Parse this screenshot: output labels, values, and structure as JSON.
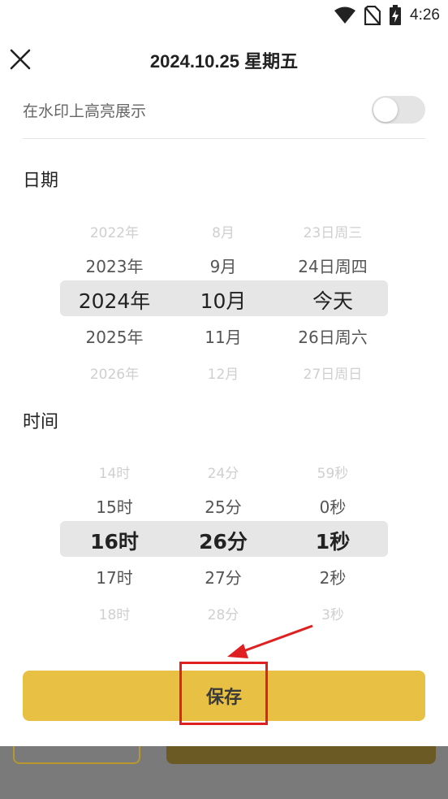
{
  "status_bar": {
    "time": "4:26",
    "icons": [
      "wifi-icon",
      "no-sim-icon",
      "battery-charging-icon"
    ]
  },
  "header": {
    "title": "2024.10.25 星期五",
    "close_icon": "close-icon"
  },
  "watermark_setting": {
    "label": "在水印上高亮展示",
    "enabled": false
  },
  "date_section": {
    "title": "日期",
    "columns": [
      {
        "name": "year",
        "items": [
          "2022年",
          "2023年",
          "2024年",
          "2025年",
          "2026年"
        ],
        "selected_index": 2
      },
      {
        "name": "month",
        "items": [
          "8月",
          "9月",
          "10月",
          "11月",
          "12月"
        ],
        "selected_index": 2
      },
      {
        "name": "day",
        "items": [
          "23日周三",
          "24日周四",
          "今天",
          "26日周六",
          "27日周日"
        ],
        "selected_index": 2
      }
    ]
  },
  "time_section": {
    "title": "时间",
    "columns": [
      {
        "name": "hour",
        "items": [
          "14时",
          "15时",
          "16时",
          "17时",
          "18时"
        ],
        "selected_index": 2
      },
      {
        "name": "minute",
        "items": [
          "24分",
          "25分",
          "26分",
          "27分",
          "28分"
        ],
        "selected_index": 2
      },
      {
        "name": "second",
        "items": [
          "59秒",
          "0秒",
          "1秒",
          "2秒",
          "3秒"
        ],
        "selected_index": 2
      }
    ]
  },
  "save_button": {
    "label": "保存"
  },
  "colors": {
    "accent": "#e8c043",
    "picker_highlight": "#e6e6e6",
    "annotation_red": "#e02020",
    "overlay": "#7a7a7a"
  }
}
